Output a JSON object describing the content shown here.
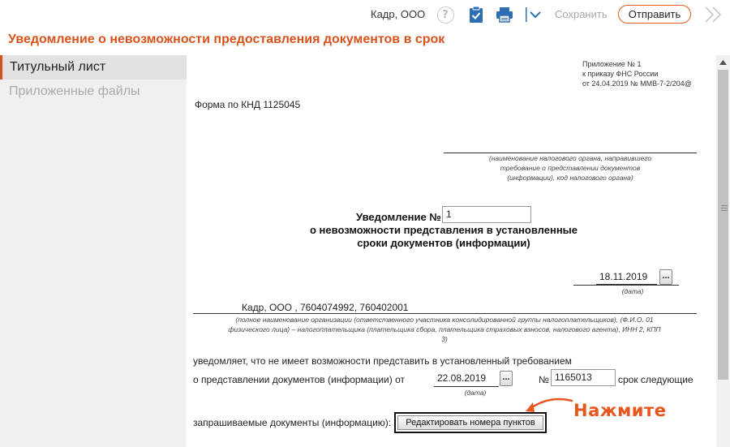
{
  "toolbar": {
    "org_name": "Кадр, ООО",
    "help_symbol": "?",
    "save_label": "Сохранить",
    "send_label": "Отправить"
  },
  "page_title": "Уведомление о невозможности предоставления документов в срок",
  "sidebar": {
    "items": [
      {
        "label": "Титульный лист",
        "active": true
      },
      {
        "label": "Приложенные файлы",
        "active": false
      }
    ]
  },
  "document": {
    "appendix_line1": "Приложение № 1",
    "appendix_line2": "к приказу ФНС России",
    "appendix_line3": "от 24.04.2019 № ММВ-7-2/204@",
    "form_knd": "Форма по КНД 1125045",
    "tax_authority_caption": "(наименование налогового органа, направившего требование о представлении документов (информации), код налогового органа)",
    "notice_label": "Уведомление №",
    "notice_number": "1",
    "notice_title_line1": "о невозможности представления в установленные",
    "notice_title_line2": "сроки документов (информации)",
    "notice_date": "18.11.2019",
    "date_caption": "(дата)",
    "organization_value": "Кадр, ООО , 7604074992, 760402001",
    "organization_caption": "(полное наименование организации (ответственного участника консолидированной группы налогоплательщиков), (Ф.И.О. 01 физического лица) – налогоплательщика (плательщика сбора, плательщика страховых взносов, налогового агента), ИНН 2, КПП 3)",
    "text_notifies": "уведомляет, что не имеет возможности представить в установленный требованием",
    "text_request_prefix": "о представлении документов (информации) от",
    "request_date": "22.08.2019",
    "number_sign": "№",
    "request_number": "1165013",
    "text_term": "срок следующие",
    "text_requested": "запрашиваемые документы (информацию):",
    "edit_button_label": "Редактировать номера пунктов",
    "dots_label": "..."
  },
  "hint_label": "Нажмите",
  "colors": {
    "accent": "#d8531c",
    "hint": "#e8561e"
  }
}
